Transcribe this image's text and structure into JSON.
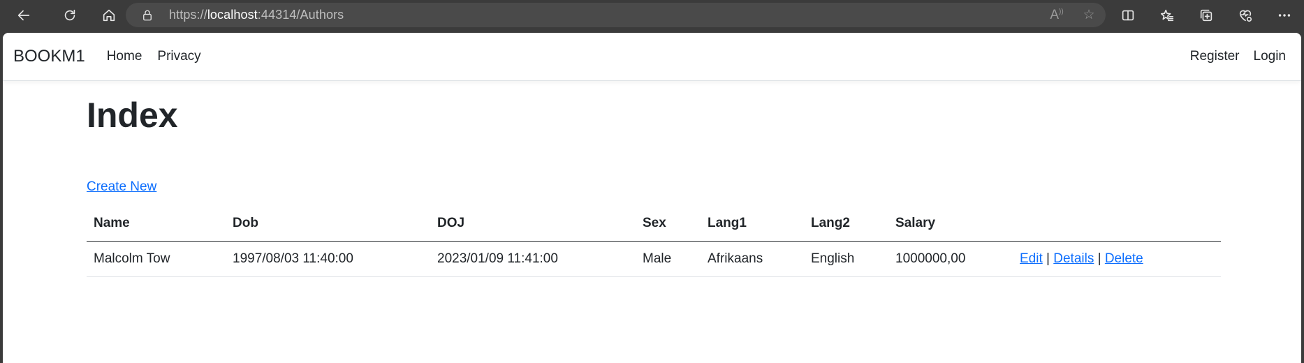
{
  "browser": {
    "url_prefix": "https://",
    "url_host": "localhost",
    "url_rest": ":44314/Authors",
    "icons": {
      "back": "back-arrow-icon",
      "reload": "reload-icon",
      "home": "home-icon",
      "lock": "lock-icon",
      "read_aloud": "read-aloud-icon",
      "favorite": "star-icon",
      "split_screen": "split-screen-icon",
      "favorites": "favorites-icon",
      "collections": "collections-icon",
      "health": "browser-essentials-icon",
      "more": "more-icon"
    }
  },
  "nav": {
    "brand": "BOOKM1",
    "links": [
      "Home",
      "Privacy"
    ],
    "right": [
      "Register",
      "Login"
    ]
  },
  "main": {
    "title": "Index",
    "create_link": "Create New",
    "columns": [
      "Name",
      "Dob",
      "DOJ",
      "Sex",
      "Lang1",
      "Lang2",
      "Salary",
      ""
    ],
    "rows": [
      {
        "name": "Malcolm Tow",
        "dob": "1997/08/03 11:40:00",
        "doj": "2023/01/09 11:41:00",
        "sex": "Male",
        "lang1": "Afrikaans",
        "lang2": "English",
        "salary": "1000000,00",
        "actions": [
          "Edit",
          "Details",
          "Delete"
        ],
        "separator": "|"
      }
    ]
  },
  "colors": {
    "link": "#0d6efd",
    "text": "#212529",
    "chrome": "#3b3b3b"
  }
}
